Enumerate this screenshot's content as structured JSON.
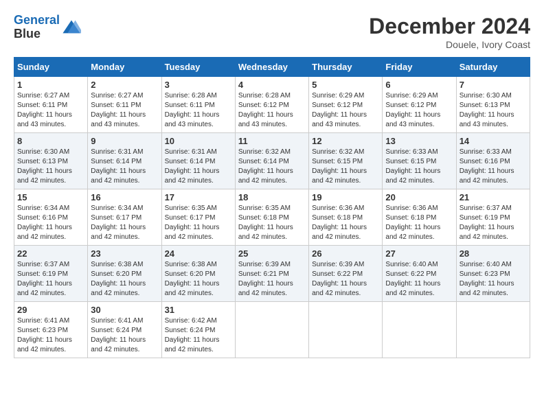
{
  "header": {
    "logo_line1": "General",
    "logo_line2": "Blue",
    "month_title": "December 2024",
    "location": "Douele, Ivory Coast"
  },
  "days_of_week": [
    "Sunday",
    "Monday",
    "Tuesday",
    "Wednesday",
    "Thursday",
    "Friday",
    "Saturday"
  ],
  "weeks": [
    [
      {
        "day": "1",
        "sunrise": "6:27 AM",
        "sunset": "6:11 PM",
        "daylight": "11 hours and 43 minutes."
      },
      {
        "day": "2",
        "sunrise": "6:27 AM",
        "sunset": "6:11 PM",
        "daylight": "11 hours and 43 minutes."
      },
      {
        "day": "3",
        "sunrise": "6:28 AM",
        "sunset": "6:11 PM",
        "daylight": "11 hours and 43 minutes."
      },
      {
        "day": "4",
        "sunrise": "6:28 AM",
        "sunset": "6:12 PM",
        "daylight": "11 hours and 43 minutes."
      },
      {
        "day": "5",
        "sunrise": "6:29 AM",
        "sunset": "6:12 PM",
        "daylight": "11 hours and 43 minutes."
      },
      {
        "day": "6",
        "sunrise": "6:29 AM",
        "sunset": "6:12 PM",
        "daylight": "11 hours and 43 minutes."
      },
      {
        "day": "7",
        "sunrise": "6:30 AM",
        "sunset": "6:13 PM",
        "daylight": "11 hours and 43 minutes."
      }
    ],
    [
      {
        "day": "8",
        "sunrise": "6:30 AM",
        "sunset": "6:13 PM",
        "daylight": "11 hours and 42 minutes."
      },
      {
        "day": "9",
        "sunrise": "6:31 AM",
        "sunset": "6:14 PM",
        "daylight": "11 hours and 42 minutes."
      },
      {
        "day": "10",
        "sunrise": "6:31 AM",
        "sunset": "6:14 PM",
        "daylight": "11 hours and 42 minutes."
      },
      {
        "day": "11",
        "sunrise": "6:32 AM",
        "sunset": "6:14 PM",
        "daylight": "11 hours and 42 minutes."
      },
      {
        "day": "12",
        "sunrise": "6:32 AM",
        "sunset": "6:15 PM",
        "daylight": "11 hours and 42 minutes."
      },
      {
        "day": "13",
        "sunrise": "6:33 AM",
        "sunset": "6:15 PM",
        "daylight": "11 hours and 42 minutes."
      },
      {
        "day": "14",
        "sunrise": "6:33 AM",
        "sunset": "6:16 PM",
        "daylight": "11 hours and 42 minutes."
      }
    ],
    [
      {
        "day": "15",
        "sunrise": "6:34 AM",
        "sunset": "6:16 PM",
        "daylight": "11 hours and 42 minutes."
      },
      {
        "day": "16",
        "sunrise": "6:34 AM",
        "sunset": "6:17 PM",
        "daylight": "11 hours and 42 minutes."
      },
      {
        "day": "17",
        "sunrise": "6:35 AM",
        "sunset": "6:17 PM",
        "daylight": "11 hours and 42 minutes."
      },
      {
        "day": "18",
        "sunrise": "6:35 AM",
        "sunset": "6:18 PM",
        "daylight": "11 hours and 42 minutes."
      },
      {
        "day": "19",
        "sunrise": "6:36 AM",
        "sunset": "6:18 PM",
        "daylight": "11 hours and 42 minutes."
      },
      {
        "day": "20",
        "sunrise": "6:36 AM",
        "sunset": "6:18 PM",
        "daylight": "11 hours and 42 minutes."
      },
      {
        "day": "21",
        "sunrise": "6:37 AM",
        "sunset": "6:19 PM",
        "daylight": "11 hours and 42 minutes."
      }
    ],
    [
      {
        "day": "22",
        "sunrise": "6:37 AM",
        "sunset": "6:19 PM",
        "daylight": "11 hours and 42 minutes."
      },
      {
        "day": "23",
        "sunrise": "6:38 AM",
        "sunset": "6:20 PM",
        "daylight": "11 hours and 42 minutes."
      },
      {
        "day": "24",
        "sunrise": "6:38 AM",
        "sunset": "6:20 PM",
        "daylight": "11 hours and 42 minutes."
      },
      {
        "day": "25",
        "sunrise": "6:39 AM",
        "sunset": "6:21 PM",
        "daylight": "11 hours and 42 minutes."
      },
      {
        "day": "26",
        "sunrise": "6:39 AM",
        "sunset": "6:22 PM",
        "daylight": "11 hours and 42 minutes."
      },
      {
        "day": "27",
        "sunrise": "6:40 AM",
        "sunset": "6:22 PM",
        "daylight": "11 hours and 42 minutes."
      },
      {
        "day": "28",
        "sunrise": "6:40 AM",
        "sunset": "6:23 PM",
        "daylight": "11 hours and 42 minutes."
      }
    ],
    [
      {
        "day": "29",
        "sunrise": "6:41 AM",
        "sunset": "6:23 PM",
        "daylight": "11 hours and 42 minutes."
      },
      {
        "day": "30",
        "sunrise": "6:41 AM",
        "sunset": "6:24 PM",
        "daylight": "11 hours and 42 minutes."
      },
      {
        "day": "31",
        "sunrise": "6:42 AM",
        "sunset": "6:24 PM",
        "daylight": "11 hours and 42 minutes."
      },
      null,
      null,
      null,
      null
    ]
  ]
}
